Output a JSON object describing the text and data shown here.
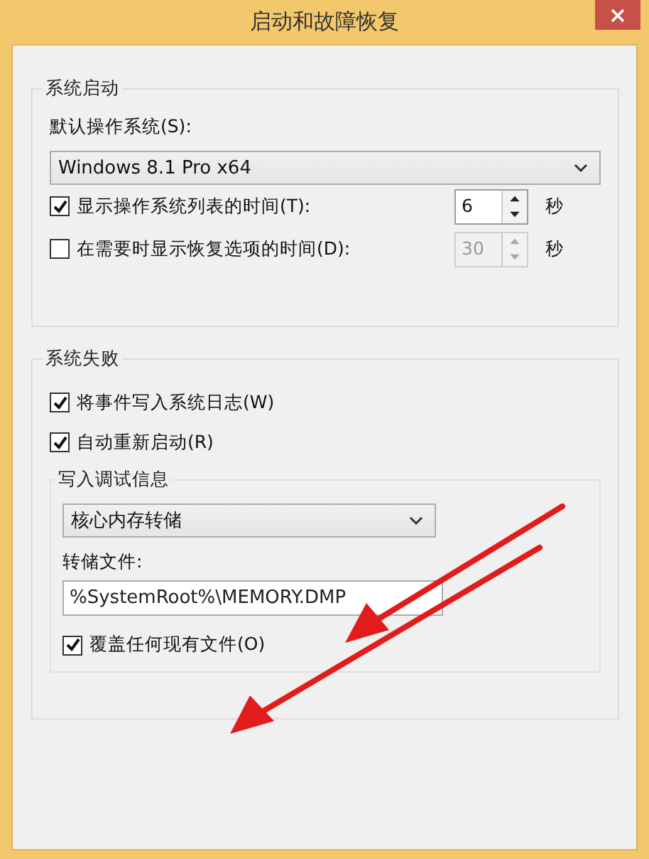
{
  "window": {
    "title": "启动和故障恢复"
  },
  "startup": {
    "title": "系统启动",
    "os_label": "默认操作系统(S):",
    "os_select": "Windows 8.1 Pro x64",
    "timeouts": [
      {
        "label": "显示操作系统列表的时间(T):",
        "checked": true,
        "value": "6",
        "disabled": false,
        "unit": "秒"
      },
      {
        "label": "在需要时显示恢复选项的时间(D):",
        "checked": false,
        "value": "30",
        "disabled": true,
        "unit": "秒"
      }
    ]
  },
  "failure": {
    "title": "系统失败",
    "options": [
      {
        "label": "将事件写入系统日志(W)",
        "checked": true
      },
      {
        "label": "自动重新启动(R)",
        "checked": true
      }
    ],
    "debug": {
      "title": "写入调试信息",
      "dump_select": "核心内存转储",
      "file_label": "转储文件:",
      "file_value": "%SystemRoot%\\MEMORY.DMP",
      "overwrite": {
        "label": "覆盖任何现有文件(O)",
        "checked": true
      }
    }
  }
}
